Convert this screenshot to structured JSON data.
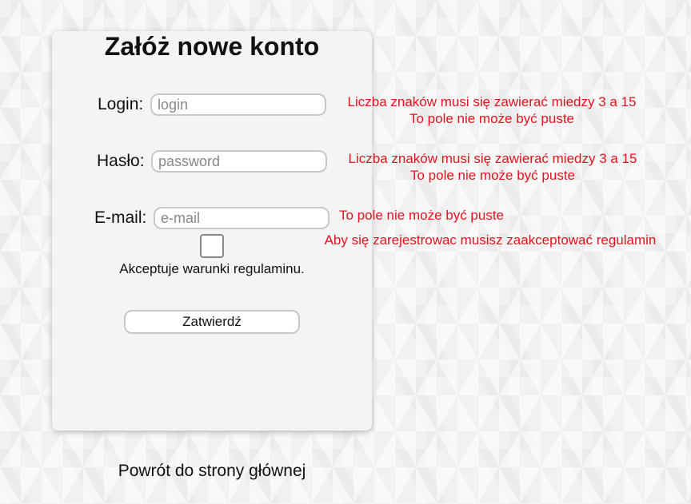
{
  "form": {
    "title": "Załóż nowe konto",
    "login": {
      "label": "Login:",
      "placeholder": "login",
      "value": "",
      "errors": [
        "Liczba znaków musi się zawierać miedzy 3 a 15",
        "To pole nie może być puste"
      ]
    },
    "password": {
      "label": "Hasło:",
      "placeholder": "password",
      "value": "",
      "errors": [
        "Liczba znaków musi się zawierać miedzy 3 a 15",
        "To pole nie może być puste"
      ]
    },
    "email": {
      "label": "E-mail:",
      "placeholder": "e-mail",
      "value": "",
      "errors": [
        "To pole nie może być puste"
      ]
    },
    "terms": {
      "label": "Akceptuje warunki regulaminu.",
      "checked": false,
      "error": "Aby się zarejestrowac musisz zaakceptować regulamin"
    },
    "submit_label": "Zatwierdź"
  },
  "footer": {
    "back_link": "Powrót do strony głównej"
  },
  "colors": {
    "error": "#e0141e",
    "panel": "#f4f4f4"
  }
}
